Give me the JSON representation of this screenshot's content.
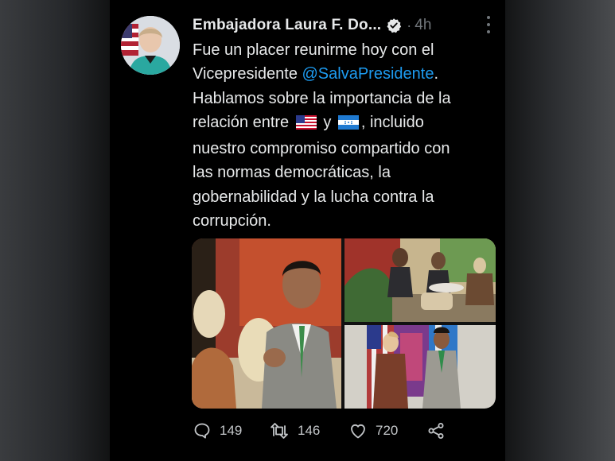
{
  "tweet": {
    "author_name": "Embajadora Laura F. Do...",
    "verified_icon": "verified-badge-icon",
    "separator": "·",
    "timestamp": "4h",
    "text_lines": [
      [
        "Fue un placer reunirme hoy con el"
      ],
      [
        "Vicepresidente ",
        "@SalvaPresidente",
        "."
      ],
      [
        "Hablamos sobre la importancia de la"
      ],
      [
        "relación entre ",
        "[us-flag]",
        " y ",
        "[hn-flag]",
        ", incluido"
      ],
      [
        "nuestro compromiso compartido con"
      ],
      [
        "las normas democráticas, la"
      ],
      [
        "gobernabilidad y la lucha contra la"
      ],
      [
        "corrupción."
      ]
    ],
    "text": {
      "l1": "Fue un placer reunirme hoy con el",
      "l2a": "Vicepresidente ",
      "mention": "@SalvaPresidente",
      "l2b": ".",
      "l3": "Hablamos sobre la importancia de la",
      "l4a": "relación entre",
      "l4b": "y",
      "l4c": ", incluido",
      "l5": "nuestro compromiso compartido con",
      "l6": "las normas democráticas, la",
      "l7": "gobernabilidad y la lucha contra la",
      "l8": "corrupción."
    },
    "emoji": [
      "us-flag-emoji",
      "honduras-flag-emoji"
    ],
    "media_count": 3,
    "actions": {
      "replies": "149",
      "retweets": "146",
      "likes": "720"
    }
  },
  "colors": {
    "background": "#000000",
    "text": "#e7e9ea",
    "secondary": "#71767b",
    "link": "#1d9bf0",
    "verified": "#e7e9ea"
  }
}
